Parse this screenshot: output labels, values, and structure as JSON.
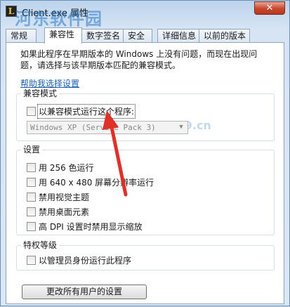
{
  "window": {
    "title": "Client.exe 属性",
    "close_glyph": "✕",
    "app_icon_glyph": "L"
  },
  "watermark": {
    "text": "河东软件园",
    "url": "www.pc0359.cn"
  },
  "tabs": [
    {
      "label": "常规",
      "active": false
    },
    {
      "label": "兼容性",
      "active": true
    },
    {
      "label": "数字签名",
      "active": false
    },
    {
      "label": "安全",
      "active": false
    },
    {
      "label": "详细信息",
      "active": false
    },
    {
      "label": "以前的版本",
      "active": false
    }
  ],
  "intro": {
    "text": "如果此程序在早期版本的 Windows 上没有问题，而现在出现问题，请选择与该早期版本匹配的兼容模式。"
  },
  "help_link": "帮助我选择设置",
  "compat_mode": {
    "label": "兼容模式",
    "checkbox_label": "以兼容模式运行这个程序:",
    "checked": false,
    "select_value": "Windows XP (Service Pack 3)"
  },
  "settings": {
    "label": "设置",
    "items": [
      {
        "label": "用 256 色运行",
        "checked": false
      },
      {
        "label": "用 640 x 480 屏幕分辨率运行",
        "checked": false
      },
      {
        "label": "禁用视觉主题",
        "checked": false
      },
      {
        "label": "禁用桌面元素",
        "checked": false
      },
      {
        "label": "高 DPI 设置时禁用显示缩放",
        "checked": false
      }
    ]
  },
  "privilege": {
    "label": "特权等级",
    "checkbox_label": "以管理员身份运行此程序",
    "checked": false
  },
  "all_users_button": "更改所有用户的设置",
  "colors": {
    "arrow": "#e0302a",
    "link": "#1a5fb4"
  }
}
